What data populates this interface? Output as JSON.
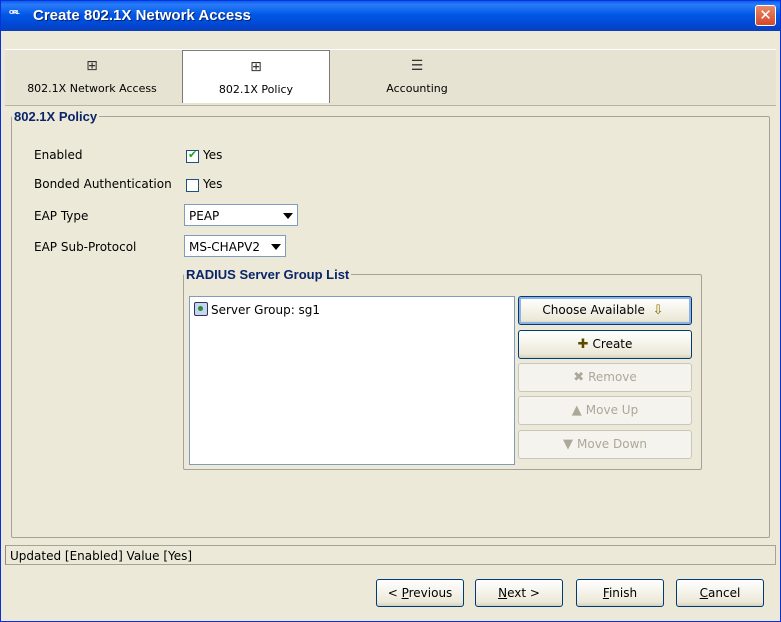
{
  "window": {
    "title": "Create 802.1X Network Access",
    "icon_text": "ᴼᴿᴸ",
    "close": "✕"
  },
  "tabs": [
    {
      "label": "802.1X Network Access",
      "icon": "grid-icon"
    },
    {
      "label": "802.1X Policy",
      "icon": "grid-icon"
    },
    {
      "label": "Accounting",
      "icon": "stack-icon"
    }
  ],
  "policy": {
    "legend": "802.1X Policy",
    "enabled_label": "Enabled",
    "enabled_value": "Yes",
    "enabled_checked": true,
    "bonded_label": "Bonded Authentication",
    "bonded_value": "Yes",
    "bonded_checked": false,
    "eap_type_label": "EAP Type",
    "eap_type_value": "PEAP",
    "eap_sub_label": "EAP Sub-Protocol",
    "eap_sub_value": "MS-CHAPV2"
  },
  "radius": {
    "legend": "RADIUS Server Group List",
    "items": [
      "Server Group: sg1"
    ],
    "buttons": {
      "choose": "Choose Available",
      "create": "Create",
      "remove": "Remove",
      "move_up": "Move Up",
      "move_down": "Move Down"
    }
  },
  "status": {
    "text": "Updated [Enabled] Value [Yes]"
  },
  "footer": {
    "previous_prefix": "< ",
    "previous_key": "P",
    "previous_rest": "revious",
    "next_key": "N",
    "next_rest": "ext >",
    "finish_key": "F",
    "finish_rest": "inish",
    "cancel_key": "C",
    "cancel_rest": "ancel"
  }
}
